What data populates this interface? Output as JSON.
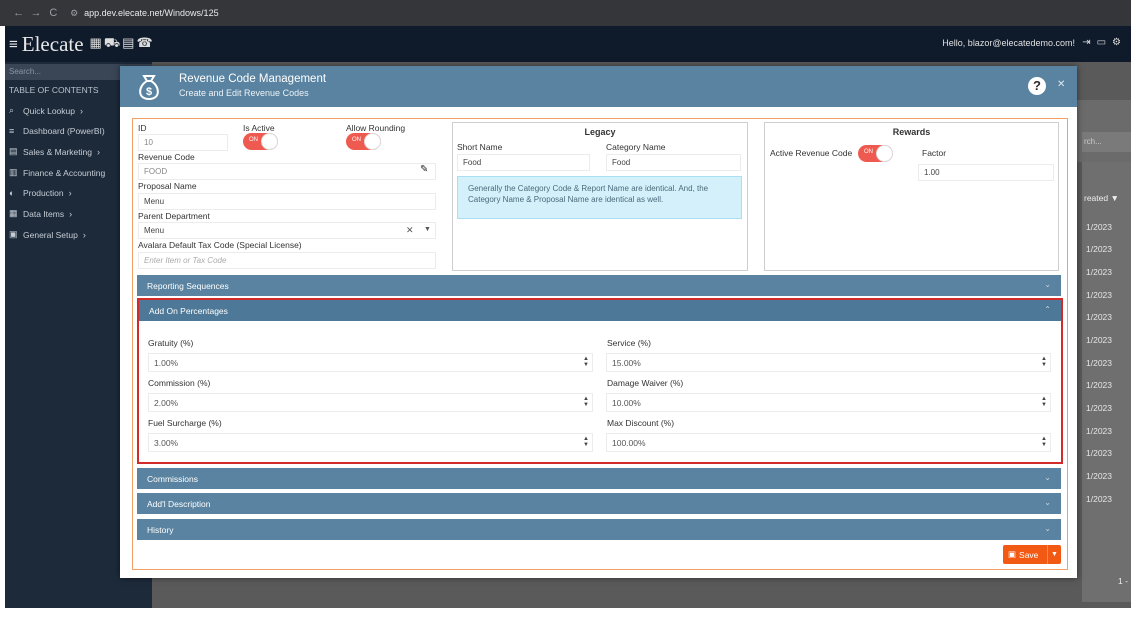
{
  "browser": {
    "url": "app.dev.elecate.net/Windows/125"
  },
  "header": {
    "brand": "Elecate",
    "hello": "Hello, blazor@elecatedemo.com!"
  },
  "sidebar": {
    "search_placeholder": "Search...",
    "toc": "TABLE OF CONTENTS",
    "items": [
      {
        "label": "Quick Lookup",
        "icon": "search-icon"
      },
      {
        "label": "Dashboard (PowerBI)",
        "icon": "menu-icon"
      },
      {
        "label": "Sales & Marketing",
        "icon": "chart-icon"
      },
      {
        "label": "Finance & Accounting",
        "icon": "bank-icon"
      },
      {
        "label": "Production",
        "icon": "production-icon"
      },
      {
        "label": "Data Items",
        "icon": "grid-icon"
      },
      {
        "label": "General Setup",
        "icon": "building-icon"
      }
    ]
  },
  "background": {
    "search_fragment": "rch...",
    "column_header": "reated",
    "dates": [
      "1/2023",
      "1/2023",
      "1/2023",
      "1/2023",
      "1/2023",
      "1/2023",
      "1/2023",
      "1/2023",
      "1/2023",
      "1/2023",
      "1/2023",
      "1/2023",
      "1/2023"
    ],
    "pager": "1 -"
  },
  "modal": {
    "title": "Revenue Code Management",
    "subtitle": "Create and Edit Revenue Codes",
    "left": {
      "id_label": "ID",
      "id_value": "10",
      "is_active_label": "Is Active",
      "allow_rounding_label": "Allow Rounding",
      "toggle_on": "ON",
      "revenue_code_label": "Revenue Code",
      "revenue_code_value": "FOOD",
      "proposal_name_label": "Proposal Name",
      "proposal_name_value": "Menu",
      "parent_department_label": "Parent Department",
      "parent_department_value": "Menu",
      "tax_code_label": "Avalara Default Tax Code (Special License)",
      "tax_code_placeholder": "Enter Item or Tax Code"
    },
    "legacy": {
      "title": "Legacy",
      "short_name_label": "Short Name",
      "short_name_value": "Food",
      "category_name_label": "Category Name",
      "category_name_value": "Food",
      "info": "Generally the Category Code & Report Name are identical. And, the Category Name & Proposal Name are identical as well."
    },
    "rewards": {
      "title": "Rewards",
      "active_label": "Active Revenue Code",
      "toggle_on": "ON",
      "factor_label": "Factor",
      "factor_value": "1.00"
    },
    "sections": {
      "reporting": "Reporting Sequences",
      "addon": "Add On Percentages",
      "commissions": "Commissions",
      "description": "Add'l Description",
      "history": "History"
    },
    "addon": {
      "gratuity_label": "Gratuity (%)",
      "gratuity_value": "1.00%",
      "service_label": "Service (%)",
      "service_value": "15.00%",
      "commission_label": "Commission (%)",
      "commission_value": "2.00%",
      "damage_label": "Damage Waiver (%)",
      "damage_value": "10.00%",
      "fuel_label": "Fuel Surcharge (%)",
      "fuel_value": "3.00%",
      "max_label": "Max Discount (%)",
      "max_value": "100.00%"
    },
    "save_label": "Save"
  }
}
